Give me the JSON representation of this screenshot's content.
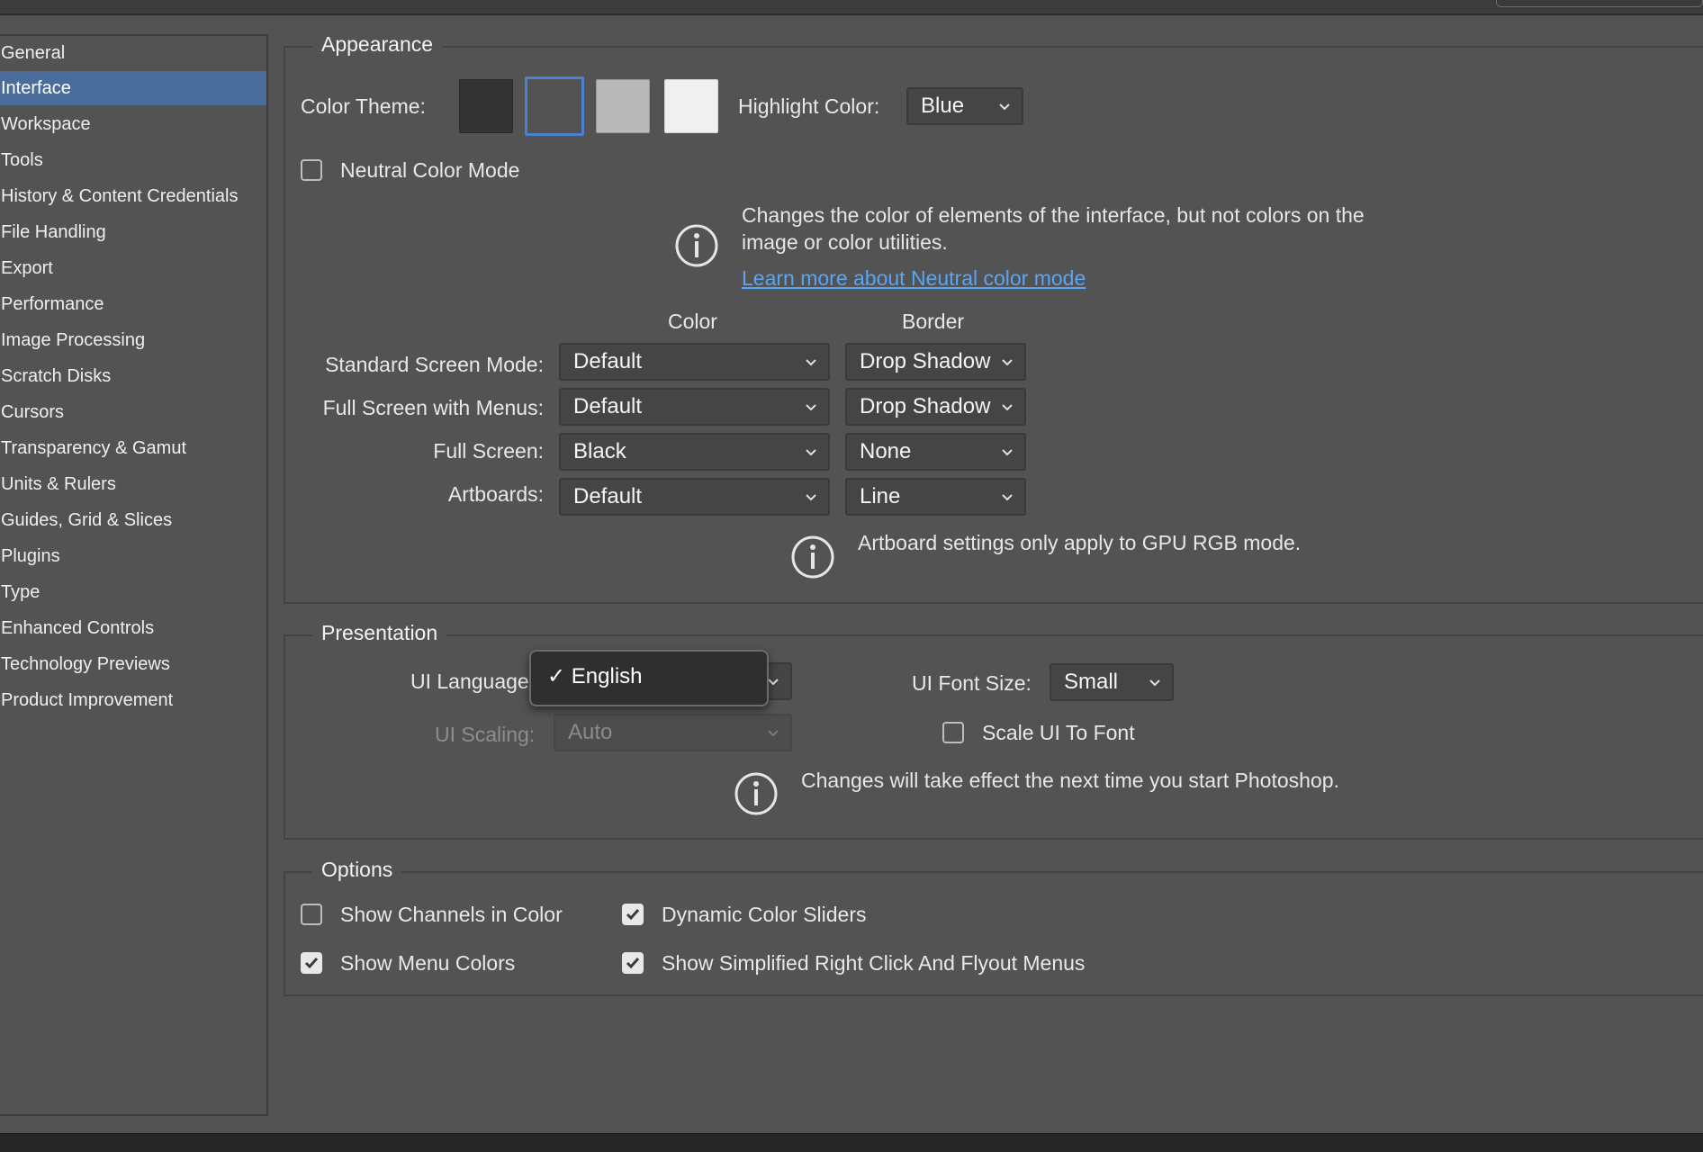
{
  "sidebar": {
    "items": [
      {
        "label": "General",
        "selected": false
      },
      {
        "label": "Interface",
        "selected": true
      },
      {
        "label": "Workspace",
        "selected": false
      },
      {
        "label": "Tools",
        "selected": false
      },
      {
        "label": "History & Content Credentials",
        "selected": false
      },
      {
        "label": "File Handling",
        "selected": false
      },
      {
        "label": "Export",
        "selected": false
      },
      {
        "label": "Performance",
        "selected": false
      },
      {
        "label": "Image Processing",
        "selected": false
      },
      {
        "label": "Scratch Disks",
        "selected": false
      },
      {
        "label": "Cursors",
        "selected": false
      },
      {
        "label": "Transparency & Gamut",
        "selected": false
      },
      {
        "label": "Units & Rulers",
        "selected": false
      },
      {
        "label": "Guides, Grid & Slices",
        "selected": false
      },
      {
        "label": "Plugins",
        "selected": false
      },
      {
        "label": "Type",
        "selected": false
      },
      {
        "label": "Enhanced Controls",
        "selected": false
      },
      {
        "label": "Technology Previews",
        "selected": false
      },
      {
        "label": "Product Improvement",
        "selected": false
      }
    ]
  },
  "appearance": {
    "title": "Appearance",
    "color_theme_label": "Color Theme:",
    "swatches": [
      "#333333",
      "#535353",
      "#b8b8b8",
      "#f0f0f0"
    ],
    "selected_swatch": 1,
    "highlight_color_label": "Highlight Color:",
    "highlight_color_value": "Blue",
    "neutral_color_mode_label": "Neutral Color Mode",
    "neutral_color_mode_checked": false,
    "neutral_info_line1": "Changes the color of elements of the interface, but not colors on the",
    "neutral_info_line2": "image or color utilities.",
    "neutral_link": "Learn more about Neutral color mode",
    "col_color": "Color",
    "col_border": "Border",
    "rows": [
      {
        "label": "Standard Screen Mode:",
        "color": "Default",
        "border": "Drop Shadow"
      },
      {
        "label": "Full Screen with Menus:",
        "color": "Default",
        "border": "Drop Shadow"
      },
      {
        "label": "Full Screen:",
        "color": "Black",
        "border": "None"
      },
      {
        "label": "Artboards:",
        "color": "Default",
        "border": "Line"
      }
    ],
    "artboard_info": "Artboard settings only apply to GPU RGB mode."
  },
  "presentation": {
    "title": "Presentation",
    "ui_language_label": "UI Language",
    "ui_language_popup_item": "✓ English",
    "ui_font_size_label": "UI Font Size:",
    "ui_font_size_value": "Small",
    "ui_scaling_label": "UI Scaling:",
    "ui_scaling_value": "Auto",
    "scale_ui_to_font_label": "Scale UI To Font",
    "scale_ui_to_font_checked": false,
    "restart_info": "Changes will take effect the next time you start Photoshop."
  },
  "options": {
    "title": "Options",
    "show_channels_in_color": {
      "label": "Show Channels in Color",
      "checked": false
    },
    "dynamic_color_sliders": {
      "label": "Dynamic Color Sliders",
      "checked": true
    },
    "show_menu_colors": {
      "label": "Show Menu Colors",
      "checked": true
    },
    "show_simplified_menus": {
      "label": "Show Simplified Right Click And Flyout Menus",
      "checked": true
    }
  },
  "colors": {
    "background": "#535353",
    "selection": "#4a6d9b",
    "link": "#58a5f5"
  }
}
